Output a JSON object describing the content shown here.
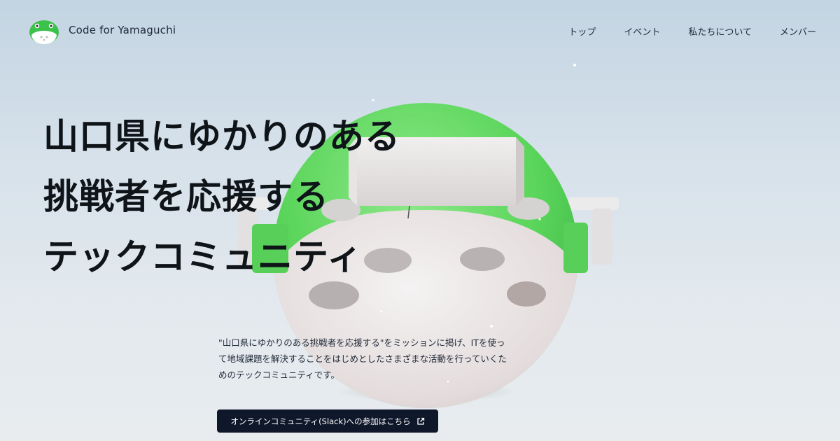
{
  "header": {
    "brand": "Code for Yamaguchi",
    "nav": [
      "トップ",
      "イベント",
      "私たちについて",
      "メンバー"
    ]
  },
  "hero": {
    "headline": [
      "山口県にゆかりのある",
      "挑戦者を応援する",
      "テックコミュニティ"
    ],
    "description": "\"山口県にゆかりのある挑戦者を応援する\"をミッションに掲げ、ITを使って地域課題を解決することをはじめとしたさまざまな活動を行っていくためのテックコミュニティです。",
    "cta_label": "オンラインコミュニティ(Slack)への参加はこちら"
  },
  "colors": {
    "accent_green": "#5ed35e",
    "button_bg": "#0f172a",
    "text_dark": "#0f1419"
  },
  "icons": {
    "logo": "mascot-logo-icon",
    "cta": "external-link-icon"
  }
}
